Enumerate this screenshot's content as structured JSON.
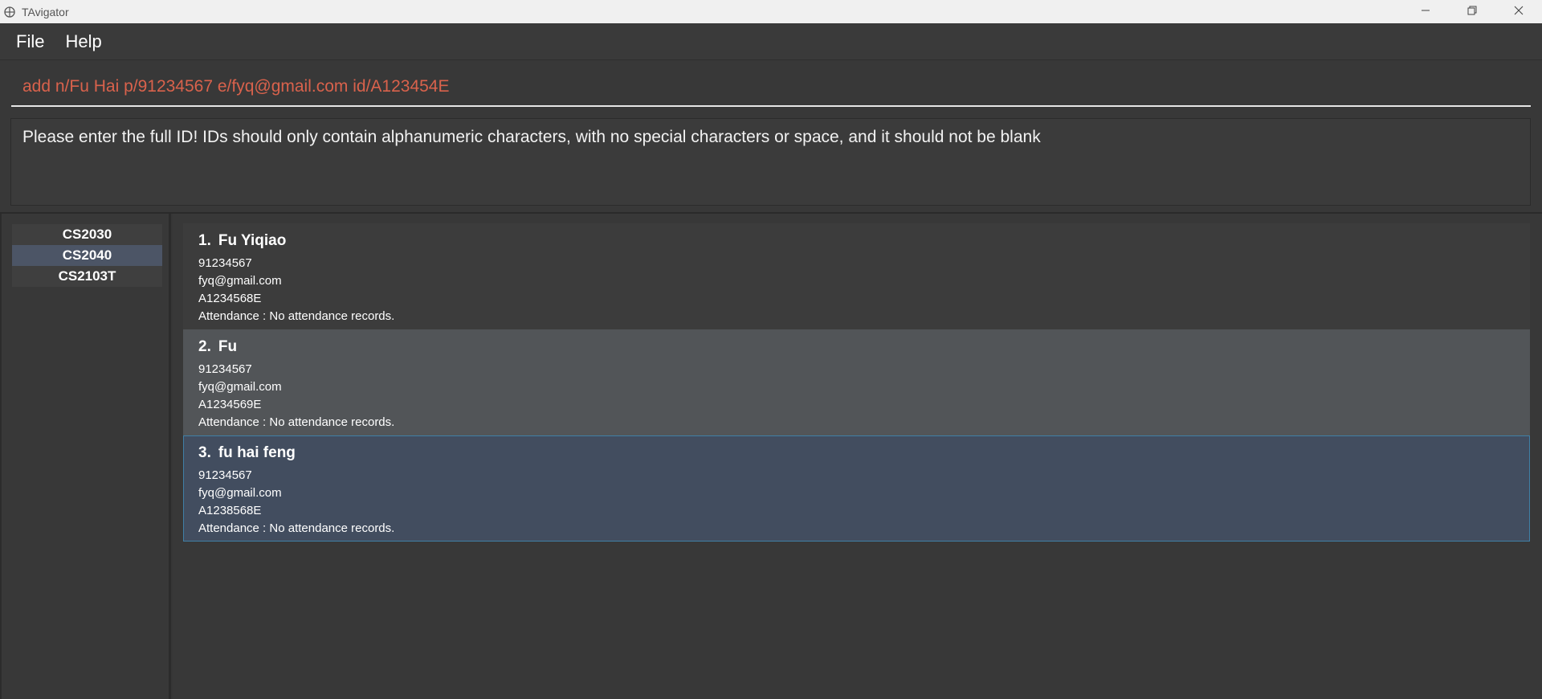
{
  "window": {
    "title": "TAvigator"
  },
  "menu": {
    "file": "File",
    "help": "Help"
  },
  "command": {
    "value": "add n/Fu Hai p/91234567 e/fyq@gmail.com id/A123454E",
    "error_color": "#d9624c"
  },
  "result": {
    "message": "Please enter the full ID! IDs should only contain alphanumeric characters, with no special characters or space, and it should not be blank"
  },
  "classes": [
    {
      "label": "CS2030",
      "selected": false
    },
    {
      "label": "CS2040",
      "selected": true
    },
    {
      "label": "CS2103T",
      "selected": false
    }
  ],
  "persons": [
    {
      "index": "1.",
      "name": "Fu Yiqiao",
      "phone": "91234567",
      "email": "fyq@gmail.com",
      "id": "A1234568E",
      "attendance": "Attendance : No attendance records."
    },
    {
      "index": "2.",
      "name": "Fu",
      "phone": "91234567",
      "email": "fyq@gmail.com",
      "id": "A1234569E",
      "attendance": "Attendance : No attendance records."
    },
    {
      "index": "3.",
      "name": "fu hai feng",
      "phone": "91234567",
      "email": "fyq@gmail.com",
      "id": "A1238568E",
      "attendance": "Attendance : No attendance records."
    }
  ],
  "colors": {
    "background": "#383838",
    "selected_class": "#4c5566",
    "selected_card": "#424d5f",
    "selected_border": "#3f7fa5"
  },
  "icons": {
    "app": "app-logo-icon",
    "minimize": "minimize-icon",
    "restore": "restore-icon",
    "close": "close-icon"
  }
}
